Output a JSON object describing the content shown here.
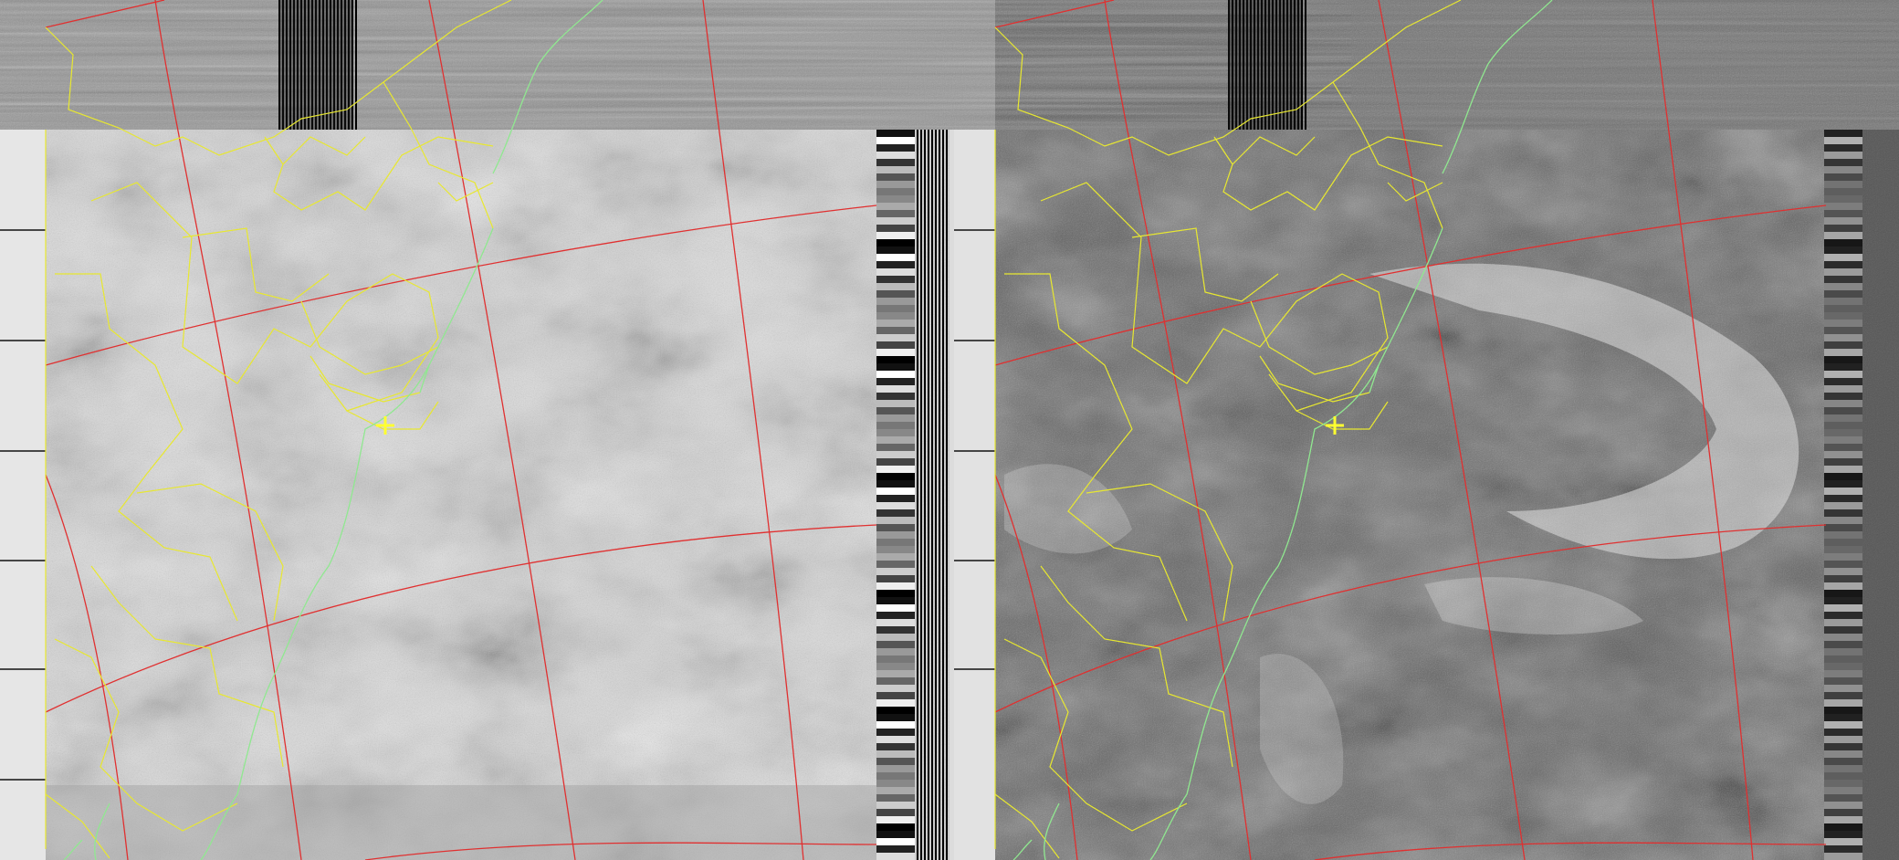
{
  "image": {
    "kind": "noaa-apt-satellite-weather-image",
    "channels": [
      {
        "name": "visible",
        "tone": "light"
      },
      {
        "name": "infrared",
        "tone": "dark"
      }
    ],
    "overlay_colors": {
      "graticule": "#e03030",
      "borders": "#e8e830",
      "coastline": "#90e890",
      "marker": "#ffff30"
    },
    "marker": "crosshair"
  }
}
